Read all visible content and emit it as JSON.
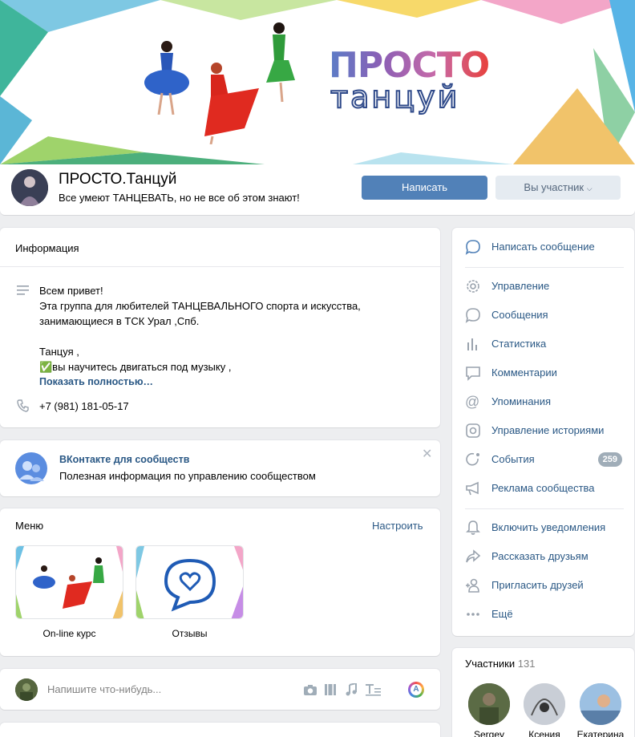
{
  "cover": {
    "title_line1": "ПРОСТО",
    "title_line2": "танцуй"
  },
  "group": {
    "name": "ПРОСТО.Танцуй",
    "status": "Все умеют ТАНЦЕВАТЬ, но не все об этом знают!",
    "write_button": "Написать",
    "member_button": "Вы участник"
  },
  "info": {
    "title": "Информация",
    "description": [
      "Всем привет!",
      "Эта группа для любителей ТАНЦЕВАЛЬНОГО спорта и искусства,",
      "занимающиеся в ТСК Урал ,Спб.",
      "",
      "Танцуя ,",
      "✅вы научитесь двигаться под музыку ,"
    ],
    "show_more": "Показать полностью…",
    "phone": "+7 (981) 181-05-17"
  },
  "promo": {
    "title": "ВКонтакте для сообществ",
    "text": "Полезная информация по управлению сообществом"
  },
  "menu": {
    "title": "Меню",
    "configure": "Настроить",
    "tiles": [
      {
        "label": "On-line курс"
      },
      {
        "label": "Отзывы"
      }
    ]
  },
  "composer": {
    "placeholder": "Напишите что-нибудь..."
  },
  "sidebar": {
    "write_message": "Написать сообщение",
    "items": [
      {
        "label": "Управление",
        "icon": "gear-icon"
      },
      {
        "label": "Сообщения",
        "icon": "message-icon"
      },
      {
        "label": "Статистика",
        "icon": "stats-icon"
      },
      {
        "label": "Комментарии",
        "icon": "comment-icon"
      },
      {
        "label": "Упоминания",
        "icon": "at-icon"
      },
      {
        "label": "Управление историями",
        "icon": "stories-icon"
      },
      {
        "label": "События",
        "icon": "events-icon",
        "badge": "259"
      },
      {
        "label": "Реклама сообщества",
        "icon": "megaphone-icon"
      }
    ],
    "items2": [
      {
        "label": "Включить уведомления",
        "icon": "bell-icon"
      },
      {
        "label": "Рассказать друзьям",
        "icon": "share-icon"
      },
      {
        "label": "Пригласить друзей",
        "icon": "invite-icon"
      },
      {
        "label": "Ещё",
        "icon": "more-icon"
      }
    ]
  },
  "members": {
    "title": "Участники",
    "count": "131",
    "list": [
      {
        "name": "Sergey"
      },
      {
        "name": "Ксения"
      },
      {
        "name": "Екатерина"
      }
    ]
  },
  "colors": {
    "accent": "#5181b8",
    "link": "#2a5885",
    "bg": "#edeef0"
  }
}
